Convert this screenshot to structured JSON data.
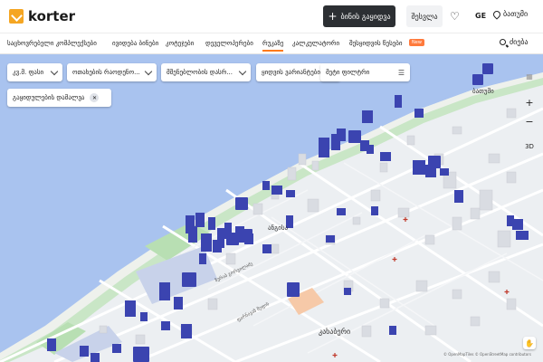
{
  "header": {
    "logo_text": "korter",
    "post_button": "ბინის გაყიდვა",
    "login_button": "შესვლა",
    "language": "GE",
    "city": "ბათუმი"
  },
  "nav": {
    "items": [
      {
        "label": "საცხოვრებელი კომპლექსები",
        "active": false
      },
      {
        "label": "ივიდება ბინები",
        "active": false
      },
      {
        "label": "კოტეჯები",
        "active": false
      },
      {
        "label": "დეველოპერები",
        "active": false
      },
      {
        "label": "რუკაზე",
        "active": true
      },
      {
        "label": "კალკულატორი",
        "active": false
      },
      {
        "label": "შესყიდვის წესები",
        "active": false
      }
    ],
    "new_badge": "New",
    "search_label": "ძიება"
  },
  "filters": {
    "price": "კვ.მ. ფასი",
    "rooms": "ოთახების რაოდენო...",
    "status": "მშენებლობის დასრ...",
    "sort": "ყიდვის ვარიანტები",
    "more": "მეტი ფილტრი",
    "hide_sold": "გაყიდულების დამალვა"
  },
  "map_controls": {
    "zoom_in": "+",
    "zoom_out": "−",
    "mode_3d": "3D"
  },
  "map_labels": {
    "district_1": "ანგისა",
    "district_2": "ბათუმი",
    "district_3": "კახაბერი",
    "street_1": "ზურაბ გორგილაძე",
    "street_2": "ფარნავაზ მეფის"
  },
  "attribution": "© OpenMapTiles  © OpenStreetMap contributors",
  "colors": {
    "accent": "#ff7a1a",
    "sea": "#a9c3ef",
    "building_marker": "#3b44b0",
    "park": "#c9e6c6"
  },
  "icons": {
    "hand": "hand-icon",
    "filter_sliders": "sliders-icon"
  }
}
